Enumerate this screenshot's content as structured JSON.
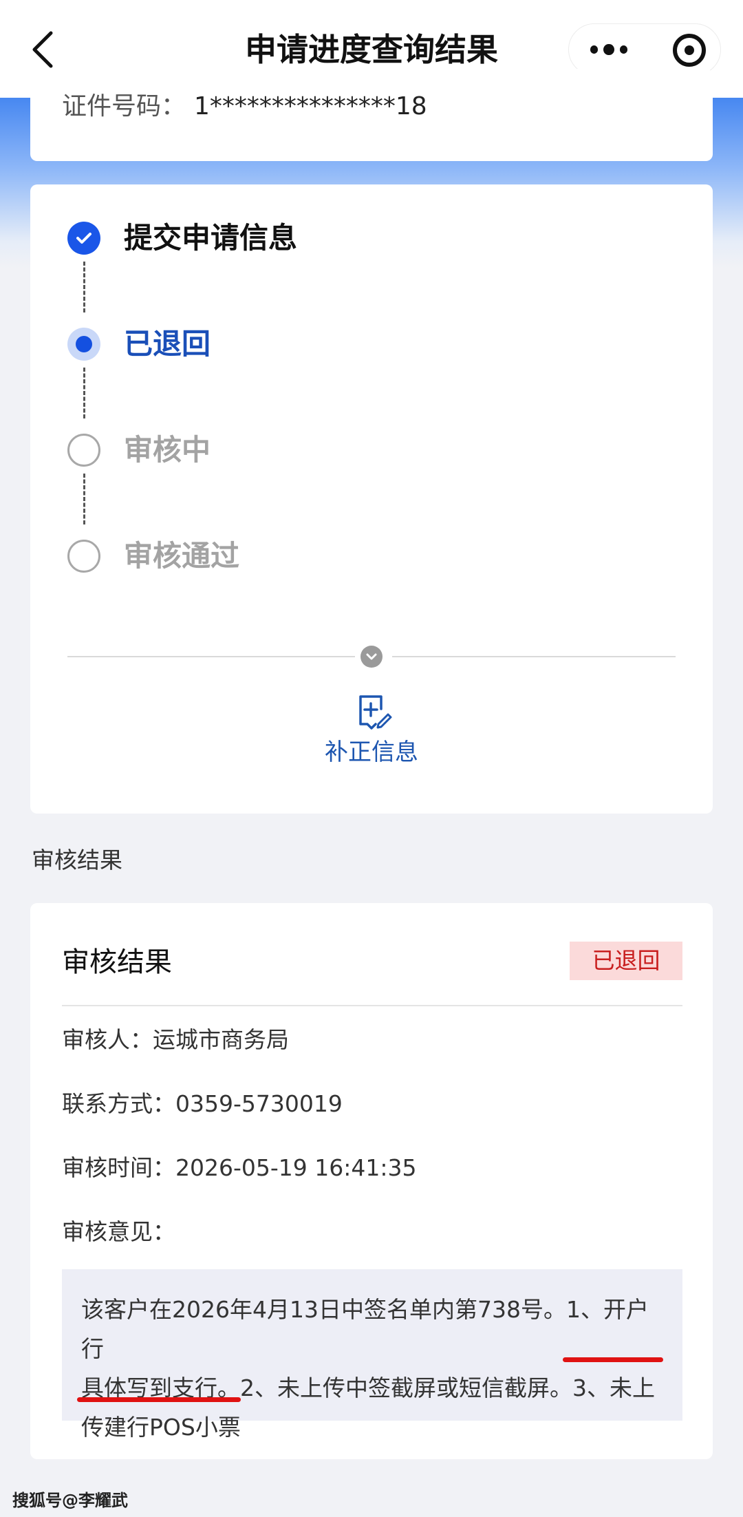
{
  "nav": {
    "title": "申请进度查询结果",
    "back_icon": "chevron-left-icon",
    "more_icon": "more-dots-icon",
    "close_icon": "target-circle-icon"
  },
  "id_info": {
    "label": "证件号码：",
    "value": "1***************18"
  },
  "steps": [
    {
      "label": "提交申请信息",
      "state": "done"
    },
    {
      "label": "已退回",
      "state": "current"
    },
    {
      "label": "审核中",
      "state": "pending"
    },
    {
      "label": "审核通过",
      "state": "pending"
    }
  ],
  "supplement": {
    "label": "补正信息",
    "icon": "edit-add-icon"
  },
  "section_title": "审核结果",
  "result": {
    "title": "审核结果",
    "badge": "已退回",
    "reviewer_label": "审核人：",
    "reviewer_value": "运城市商务局",
    "contact_label": "联系方式：",
    "contact_value": "0359-5730019",
    "time_label": "审核时间：",
    "time_value": "2026-05-19 16:41:35",
    "opinion_label": "审核意见：",
    "opinion_lines": [
      "该客户在2026年4月13日中签名单内第738号。1、开户行",
      "具体写到支行。2、未上传中签截屏或短信截屏。3、未上",
      "传建行POS小票"
    ]
  },
  "colors": {
    "accent": "#1a56e8",
    "current_text": "#1a4fb8",
    "badge_bg": "#fbdada",
    "badge_text": "#c81e1e",
    "underline": "#e01212"
  },
  "watermark": "搜狐号@李耀武"
}
